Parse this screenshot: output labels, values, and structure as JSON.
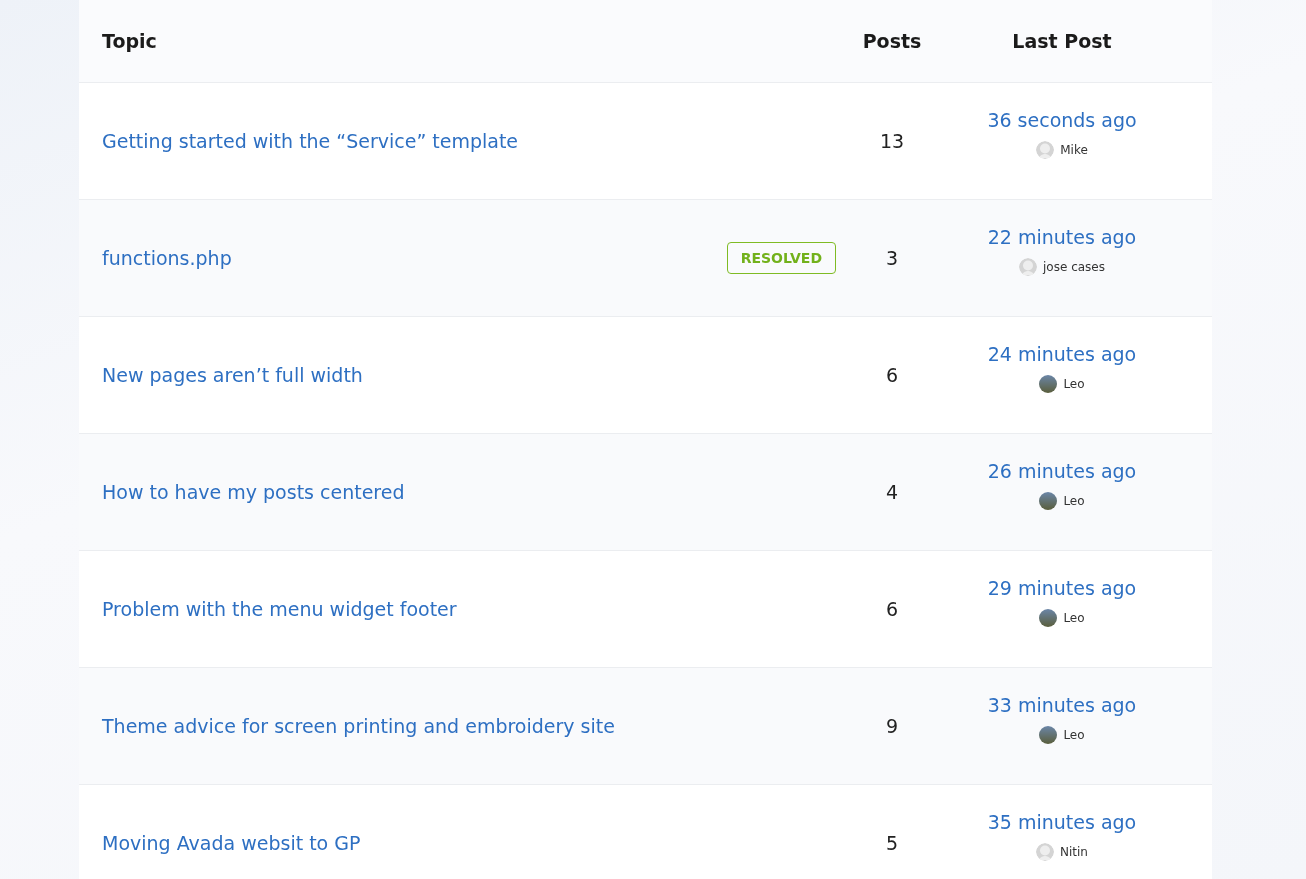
{
  "columns": [
    "Topic",
    "Posts",
    "Last Post"
  ],
  "topics": [
    {
      "title": "Getting started with the “Service” template",
      "posts": "13",
      "last_post": "36 seconds ago",
      "author": "Mike",
      "kind": "default"
    },
    {
      "title": "functions.php",
      "badge": "RESOLVED",
      "posts": "3",
      "last_post": "22 minutes ago",
      "author": "jose cases",
      "kind": "default"
    },
    {
      "title": "New pages aren’t full width",
      "posts": "6",
      "last_post": "24 minutes ago",
      "author": "Leo",
      "kind": "photo"
    },
    {
      "title": "How to have my posts centered",
      "posts": "4",
      "last_post": "26 minutes ago",
      "author": "Leo",
      "kind": "photo"
    },
    {
      "title": "Problem with the menu widget footer",
      "posts": "6",
      "last_post": "29 minutes ago",
      "author": "Leo",
      "kind": "photo"
    },
    {
      "title": "Theme advice for screen printing and embroidery site",
      "posts": "9",
      "last_post": "33 minutes ago",
      "author": "Leo",
      "kind": "photo"
    },
    {
      "title": "Moving Avada websit to GP",
      "posts": "5",
      "last_post": "35 minutes ago",
      "author": "Nitin",
      "kind": "default"
    }
  ]
}
